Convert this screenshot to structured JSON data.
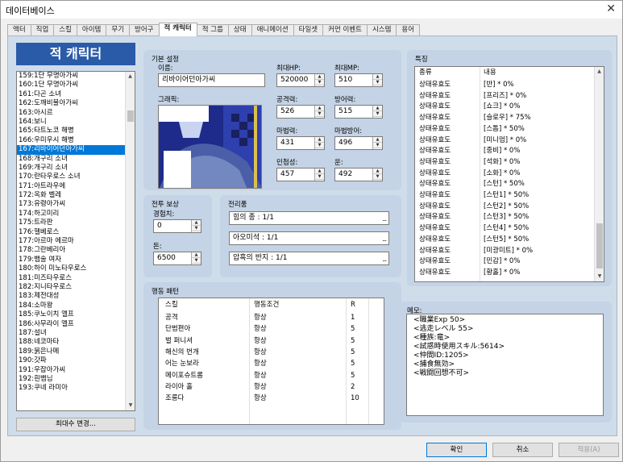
{
  "window": {
    "title": "데이터베이스",
    "close": "✕"
  },
  "tabs": [
    "액터",
    "직업",
    "스킬",
    "아이템",
    "무기",
    "방어구",
    "적 캐릭터",
    "적 그룹",
    "상태",
    "애니메이션",
    "타일셋",
    "커먼 이벤트",
    "시스템",
    "용어"
  ],
  "sidebar": {
    "title": "적 캐릭터",
    "items": [
      "159:1단 무명아가씨",
      "160:1단 무명아가씨",
      "161:다곤 소녀",
      "162:도깨비불아가씨",
      "163:아시르",
      "164:보니",
      "165:타트노코 해병",
      "166:우미우시 해병",
      "167:리바이어던아가씨",
      "168:개구리 소녀",
      "169:개구리 소녀",
      "170:란타우로스 소녀",
      "171:아트라우에",
      "172:옥화 벨레",
      "173:유령아가씨",
      "174:하고미리",
      "175:트라판",
      "176:헬베로스",
      "177:아르마 에르마",
      "178:그란베리아",
      "179:뱀술 여자",
      "180:하이 미노타우로스",
      "181:미즈타우로스",
      "182:지니타우로스",
      "183:제전대성",
      "184:소마왕",
      "185:쿠노이치 엘프",
      "186:사무라이 엘프",
      "187:설녀",
      "188:네코마타",
      "189:붉은나메",
      "190:갓파",
      "191:우잡아가씨",
      "192:흰뱀님",
      "193:쿠네 라미아"
    ],
    "selected": 8,
    "change_max_button": "최대수 변경..."
  },
  "basic": {
    "section": "기본 설정",
    "name_label": "이름:",
    "name": "리바이어던아가씨",
    "graphic_label": "그래픽:",
    "maxhp_label": "최대HP:",
    "maxhp": "520000",
    "maxmp_label": "최대MP:",
    "maxmp": "510",
    "atk_label": "공격력:",
    "atk": "526",
    "def_label": "방어력:",
    "def": "515",
    "mat_label": "마법력:",
    "mat": "431",
    "mdf_label": "마법방어:",
    "mdf": "496",
    "agi_label": "민첩성:",
    "agi": "457",
    "luk_label": "운:",
    "luk": "492"
  },
  "reward": {
    "section": "전투 보상",
    "exp_label": "경험치:",
    "exp": "0",
    "gold_label": "돈:",
    "gold": "6500"
  },
  "drops": {
    "section": "전리품",
    "items": [
      "힘의 종 : 1/1",
      "아오미석 : 1/1",
      "압흑의 반지 : 1/1"
    ],
    "dots": "..."
  },
  "actions": {
    "section": "행동 패턴",
    "headers": [
      "스킬",
      "행동조건",
      "R"
    ],
    "rows": [
      [
        "공격",
        "항상",
        "1"
      ],
      [
        "단범편아",
        "항상",
        "5"
      ],
      [
        "벌 퍼니셔",
        "항상",
        "5"
      ],
      [
        "해신의 번개",
        "항상",
        "5"
      ],
      [
        "어는 눈보라",
        "항상",
        "5"
      ],
      [
        "메이포슈트롬",
        "항상",
        "5"
      ],
      [
        "라이아 홀",
        "항상",
        "2"
      ],
      [
        "조롱다",
        "항상",
        "10"
      ]
    ]
  },
  "traits": {
    "section": "특징",
    "headers": [
      "종류",
      "내용"
    ],
    "rows": [
      [
        "상태유효도",
        "[반] * 0%"
      ],
      [
        "상태유효도",
        "[프리즈] * 0%"
      ],
      [
        "상태유효도",
        "[쇼크] * 0%"
      ],
      [
        "상태유효도",
        "[슬로우] * 75%"
      ],
      [
        "상태유효도",
        "[스톱] * 50%"
      ],
      [
        "상태유효도",
        "[미니멈] * 0%"
      ],
      [
        "상태유효도",
        "[중비] * 0%"
      ],
      [
        "상태유효도",
        "[석화] * 0%"
      ],
      [
        "상태유효도",
        "[소화] * 0%"
      ],
      [
        "상태유효도",
        "[스턴] * 50%"
      ],
      [
        "상태유효도",
        "[스턴1] * 50%"
      ],
      [
        "상태유효도",
        "[스턴2] * 50%"
      ],
      [
        "상태유효도",
        "[스턴3] * 50%"
      ],
      [
        "상태유효도",
        "[스턴4] * 50%"
      ],
      [
        "상태유효도",
        "[스턴5] * 50%"
      ],
      [
        "상태유효도",
        "[미광미트] * 0%"
      ],
      [
        "상태유효도",
        "[민감] * 0%"
      ],
      [
        "상태유효도",
        "[황홀] * 0%"
      ]
    ]
  },
  "memo": {
    "section": "메모:",
    "lines": [
      "<職業Exp 50>",
      "<逃走レベル 55>",
      "<種族:竜>",
      "<試惑時使用スキル:5614>",
      "<仲間ID:1205>",
      "<捕食無効>",
      "<戦闘回想不可>"
    ]
  },
  "footer": {
    "ok": "확인",
    "cancel": "취소",
    "apply": "적용(A)"
  }
}
